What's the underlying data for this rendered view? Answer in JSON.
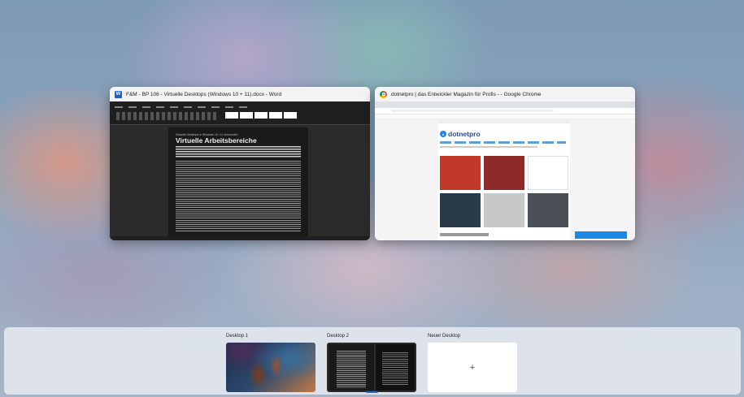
{
  "windows": [
    {
      "title": "F&M - BP 106 - Virtuelle Desktops (Windows 10 + 11).docx - Word",
      "icon": "word-icon",
      "document": {
        "heading": "Virtuelle Arbeitsbereiche",
        "kicker": "Virtuelle Desktops in Windows 10 / 11 verwenden"
      }
    },
    {
      "title": "dotnetpro | das Entwickler Magazin für Profis - - Google Chrome",
      "icon": "chrome-icon",
      "site": {
        "logo": "dotnetpro",
        "tiles": [
          "#c0392b",
          "#8e2a2a",
          "#ffffff",
          "#2b3a4a",
          "#c8c8c8",
          "#4a5055"
        ]
      }
    }
  ],
  "desktops": [
    {
      "label": "Desktop 1"
    },
    {
      "label": "Desktop 2"
    },
    {
      "label": "Neuer Desktop",
      "plus": "+"
    }
  ],
  "colors": {
    "accent": "#2a63c7",
    "word_blue": "#1f5fbf"
  }
}
